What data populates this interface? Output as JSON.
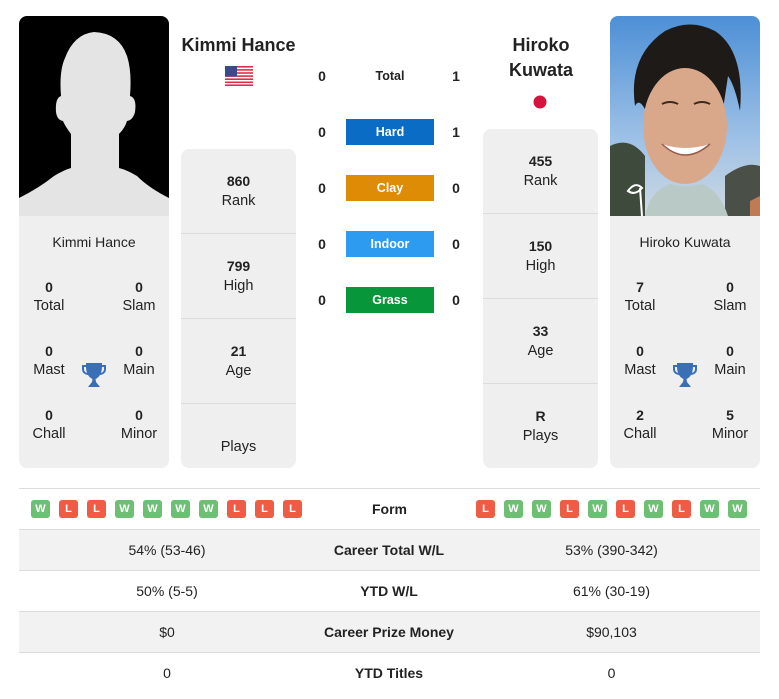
{
  "player1": {
    "name": "Kimmi Hance",
    "card_name": "Kimmi Hance",
    "country_flag": "usa-flag",
    "titles": {
      "total": {
        "value": "0",
        "label": "Total"
      },
      "slam": {
        "value": "0",
        "label": "Slam"
      },
      "mast": {
        "value": "0",
        "label": "Mast"
      },
      "main": {
        "value": "0",
        "label": "Main"
      },
      "chall": {
        "value": "0",
        "label": "Chall"
      },
      "minor": {
        "value": "0",
        "label": "Minor"
      }
    },
    "stats": [
      {
        "value": "860",
        "label": "Rank"
      },
      {
        "value": "799",
        "label": "High"
      },
      {
        "value": "21",
        "label": "Age"
      },
      {
        "value": "",
        "label": "Plays"
      }
    ],
    "form": [
      "W",
      "L",
      "L",
      "W",
      "W",
      "W",
      "W",
      "L",
      "L",
      "L"
    ]
  },
  "player2": {
    "name_line1": "Hiroko",
    "name_line2": "Kuwata",
    "card_name": "Hiroko Kuwata",
    "country_flag": "japan-flag",
    "titles": {
      "total": {
        "value": "7",
        "label": "Total"
      },
      "slam": {
        "value": "0",
        "label": "Slam"
      },
      "mast": {
        "value": "0",
        "label": "Mast"
      },
      "main": {
        "value": "0",
        "label": "Main"
      },
      "chall": {
        "value": "2",
        "label": "Chall"
      },
      "minor": {
        "value": "5",
        "label": "Minor"
      }
    },
    "stats": [
      {
        "value": "455",
        "label": "Rank"
      },
      {
        "value": "150",
        "label": "High"
      },
      {
        "value": "33",
        "label": "Age"
      },
      {
        "value": "R",
        "label": "Plays"
      }
    ],
    "form": [
      "L",
      "W",
      "W",
      "L",
      "W",
      "L",
      "W",
      "L",
      "W",
      "W"
    ]
  },
  "h2h": [
    {
      "label": "Total",
      "p1": "0",
      "p2": "1",
      "color": ""
    },
    {
      "label": "Hard",
      "p1": "0",
      "p2": "1",
      "color": "#0a6cc4"
    },
    {
      "label": "Clay",
      "p1": "0",
      "p2": "0",
      "color": "#de8b06"
    },
    {
      "label": "Indoor",
      "p1": "0",
      "p2": "0",
      "color": "#2d9bf0"
    },
    {
      "label": "Grass",
      "p1": "0",
      "p2": "0",
      "color": "#08963b"
    }
  ],
  "table": {
    "form_label": "Form",
    "rows": [
      {
        "label": "Career Total W/L",
        "p1": "54% (53-46)",
        "p2": "53% (390-342)"
      },
      {
        "label": "YTD W/L",
        "p1": "50% (5-5)",
        "p2": "61% (30-19)"
      },
      {
        "label": "Career Prize Money",
        "p1": "$0",
        "p2": "$90,103"
      },
      {
        "label": "YTD Titles",
        "p1": "0",
        "p2": "0"
      }
    ]
  },
  "colors": {
    "win": "#6dbf73",
    "loss": "#ef5b45",
    "trophy": "#3a6fb8",
    "panel": "#efefef"
  }
}
